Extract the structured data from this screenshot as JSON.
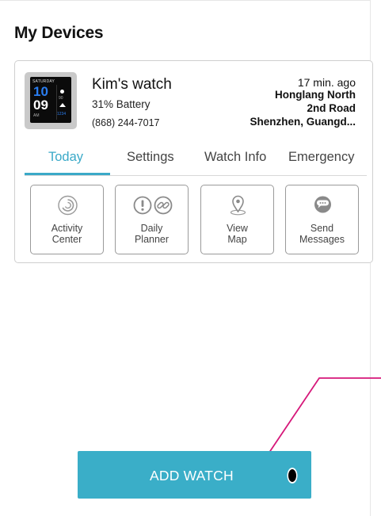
{
  "page": {
    "title": "My Devices"
  },
  "device": {
    "name": "Kim's watch",
    "battery": "31% Battery",
    "phone": "(868) 244-7017",
    "last_seen": "17 min. ago",
    "address": [
      "Honglang North",
      "2nd Road",
      "Shenzhen, Guangd..."
    ],
    "watch_face": {
      "day": "SATURDAY",
      "hour": "10",
      "minute": "09",
      "ampm": "AM",
      "stat1": "90",
      "stat2": "1234"
    }
  },
  "tabs": [
    {
      "label": "Today",
      "active": true
    },
    {
      "label": "Settings",
      "active": false
    },
    {
      "label": "Watch Info",
      "active": false
    },
    {
      "label": "Emergency",
      "active": false
    }
  ],
  "tiles": [
    {
      "line1": "Activity",
      "line2": "Center",
      "icon": "activity-ring-icon"
    },
    {
      "line1": "Daily",
      "line2": "Planner",
      "icon": "alert-and-link-icon"
    },
    {
      "line1": "View",
      "line2": "Map",
      "icon": "map-pin-icon"
    },
    {
      "line1": "Send",
      "line2": "Messages",
      "icon": "chat-bubble-icon"
    }
  ],
  "add_button": {
    "label": "ADD WATCH"
  },
  "colors": {
    "accent": "#3aa9c8",
    "button": "#3aaec8",
    "annotation": "#d6187a"
  }
}
